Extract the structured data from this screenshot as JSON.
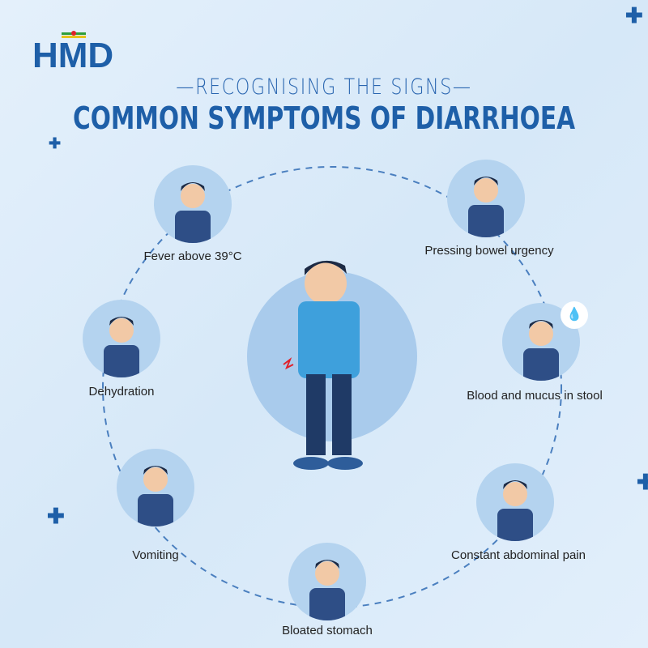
{
  "logo": {
    "text": "HMD"
  },
  "header": {
    "subtitle": "—RECOGNISING THE SIGNS—",
    "title": "COMMON SYMPTOMS OF DIARRHOEA"
  },
  "symptoms": [
    {
      "label": "Fever above 39°C"
    },
    {
      "label": "Pressing bowel urgency"
    },
    {
      "label": "Dehydration"
    },
    {
      "label": "Blood and mucus in stool"
    },
    {
      "label": "Vomiting"
    },
    {
      "label": "Constant abdominal pain"
    },
    {
      "label": "Bloated stomach"
    }
  ],
  "colors": {
    "brand": "#1e5fa8",
    "circle": "#b4d3ef",
    "accent": "#e0202a"
  }
}
